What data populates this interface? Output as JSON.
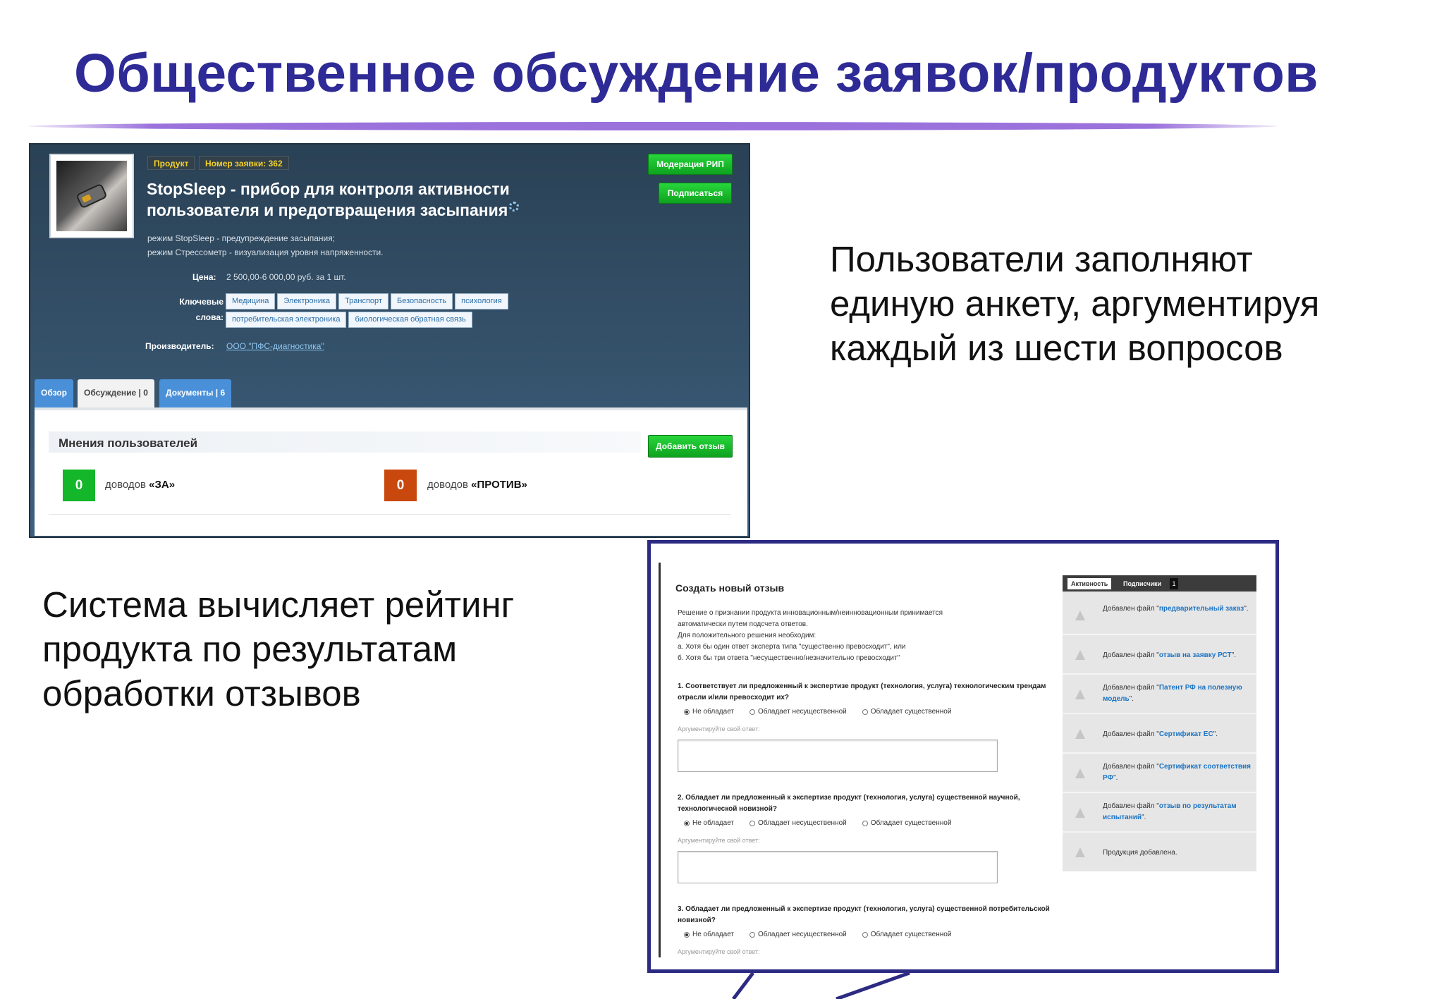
{
  "slide": {
    "title": "Общественное обсуждение заявок/продуктов",
    "caption_right": "Пользователи заполняют единую анкету, аргументируя каждый из шести вопросов",
    "caption_left": "Система вычисляет рейтинг продукта по результатам обработки отзывов"
  },
  "product": {
    "tag_type": "Продукт",
    "tag_number": "Номер заявки: 362",
    "moderation_button": "Модерация РИП",
    "subscribe_button": "Подписаться",
    "title": "StopSleep - прибор для контроля активности пользователя и предотвращения засыпания",
    "desc_line1": "режим StopSleep - предупреждение засыпания;",
    "desc_line2": "режим Стрессометр - визуализация уровня напряженности.",
    "price_label": "Цена:",
    "price_value": "2 500,00-6 000,00 руб. за 1 шт.",
    "keywords_label_1": "Ключевые",
    "keywords_label_2": "слова:",
    "keywords_row1": [
      "Медицина",
      "Электроника",
      "Транспорт",
      "Безопасность",
      "психология"
    ],
    "keywords_row2": [
      "потребительская электроника",
      "биологическая обратная связь"
    ],
    "maker_label": "Производитель:",
    "maker_value": "ООО \"ПФС-диагностика\"",
    "tabs": [
      "Обзор",
      "Обсуждение | 0",
      "Документы | 6"
    ],
    "opinions_title": "Мнения пользователей",
    "add_review_button": "Добавить отзыв",
    "pro_count": "0",
    "pro_text": "доводов",
    "pro_label": "«ЗА»",
    "con_count": "0",
    "con_text": "доводов",
    "con_label": "«ПРОТИВ»"
  },
  "review_form": {
    "title": "Создать новый отзыв",
    "intro": [
      "Решение о признании продукта инновационным/неинновационным принимается",
      "автоматически путем подсчета ответов.",
      "Для положительного решения необходим:",
      "а. Хотя бы один ответ эксперта типа \"существенно превосходит\", или",
      "б. Хотя бы три ответа \"несущественно/незначительно превосходит\""
    ],
    "questions": [
      "1. Соответствует ли предложенный к экспертизе продукт (технология, услуга) технологическим трендам отрасли и/или превосходит их?",
      "2. Обладает ли предложенный к экспертизе продукт (технология, услуга) существенной научной, технологической новизной?",
      "3. Обладает ли предложенный к экспертизе продукт (технология, услуга) существенной потребительской новизной?"
    ],
    "options": [
      "Не обладает",
      "Обладает несущественной",
      "Обладает существенной"
    ],
    "argument_label": "Аргументируйте свой ответ:"
  },
  "activity": {
    "tab_activity": "Активность",
    "tab_subscribers": "Подписчики",
    "subscribers_count": "1",
    "items": [
      {
        "prefix": "Добавлен файл \"",
        "link": "предварительный заказ",
        "suffix": "\"."
      },
      {
        "prefix": "Добавлен файл \"",
        "link": "отзыв на заявку РСТ",
        "suffix": "\"."
      },
      {
        "prefix": "Добавлен файл \"",
        "link": "Патент РФ на полезную модель",
        "suffix": "\"."
      },
      {
        "prefix": "Добавлен файл \"",
        "link": "Сертификат ЕС",
        "suffix": "\"."
      },
      {
        "prefix": "Добавлен файл \"",
        "link": "Сертификат соответствия РФ",
        "suffix": "\"."
      },
      {
        "prefix": "Добавлен файл \"",
        "link": "отзыв по результатам испытаний",
        "suffix": "\"."
      },
      {
        "prefix": "Продукция добавлена.",
        "link": "",
        "suffix": ""
      }
    ]
  },
  "colors": {
    "title": "#2e2a96",
    "callout_border": "#2c2a82",
    "green_button": "#14b62a",
    "con_counter": "#c9480e",
    "link": "#1b74c4"
  }
}
